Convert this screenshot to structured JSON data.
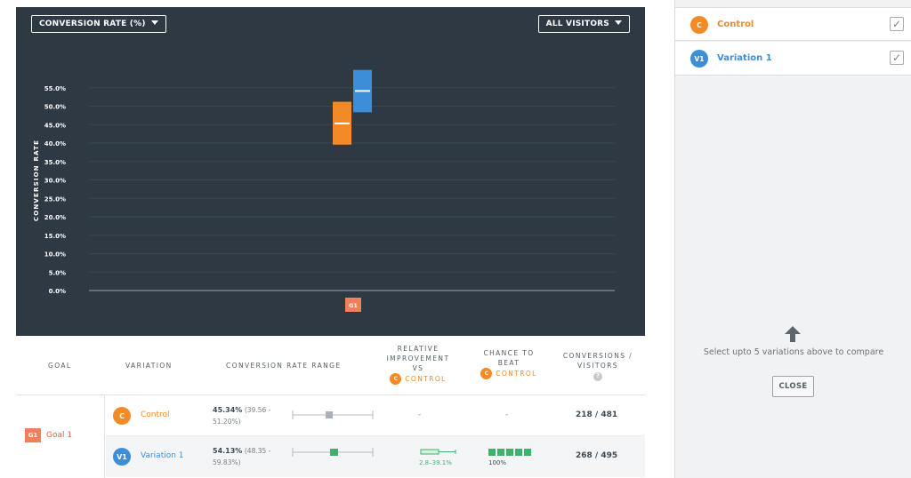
{
  "chart": {
    "metric_dropdown": "CONVERSION RATE (%)",
    "segment_dropdown": "ALL VISITORS",
    "goal_marker": "G1"
  },
  "chart_data": {
    "type": "box",
    "ylabel": "CONVERSION RATE",
    "ylim": [
      0,
      55
    ],
    "yticks": [
      "0.0%",
      "5.0%",
      "10.0%",
      "15.0%",
      "20.0%",
      "25.0%",
      "30.0%",
      "35.0%",
      "40.0%",
      "45.0%",
      "50.0%",
      "55.0%"
    ],
    "grid": true,
    "categories": [
      "G1"
    ],
    "series": [
      {
        "name": "Control",
        "color": "#f28a25",
        "median": 45.34,
        "low": 39.56,
        "high": 51.2
      },
      {
        "name": "Variation 1",
        "color": "#3c8ed8",
        "median": 54.13,
        "low": 48.35,
        "high": 59.83
      }
    ]
  },
  "table": {
    "headers": {
      "goal": "GOAL",
      "variation": "VARIATION",
      "range": "CONVERSION RATE RANGE",
      "improvement_line1": "RELATIVE",
      "improvement_line2": "IMPROVEMENT",
      "improvement_line3": "VS",
      "chance_line1": "CHANCE TO",
      "chance_line2": "BEAT",
      "reference_badge": "C",
      "reference_label": "CONTROL",
      "conversions_line1": "CONVERSIONS /",
      "conversions_line2": "VISITORS",
      "help_icon": "?"
    },
    "goal": {
      "badge": "G1",
      "label": "Goal 1"
    },
    "rows": [
      {
        "badge": "C",
        "name": "Control",
        "rate_main": "45.34%",
        "rate_range_a": "(39.56 -",
        "rate_range_b": "51.20%)",
        "improvement": "-",
        "chance": "-",
        "conversions": "218 / 481"
      },
      {
        "badge": "V1",
        "name": "Variation 1",
        "rate_main": "54.13%",
        "rate_range_a": "(48.35 -",
        "rate_range_b": "59.83%)",
        "improvement": "2.8–39.1%",
        "chance": "100%",
        "conversions": "268 / 495"
      }
    ]
  },
  "sidebar": {
    "items": [
      {
        "badge": "C",
        "label": "Control",
        "checked": true
      },
      {
        "badge": "V1",
        "label": "Variation 1",
        "checked": true
      }
    ],
    "hint": "Select upto 5 variations above to compare",
    "close_label": "CLOSE"
  },
  "colors": {
    "control": "#f28a25",
    "variation": "#3c8ed8",
    "goal": "#f07f5e",
    "positive": "#3db26b",
    "chart_bg": "#2e3944"
  }
}
